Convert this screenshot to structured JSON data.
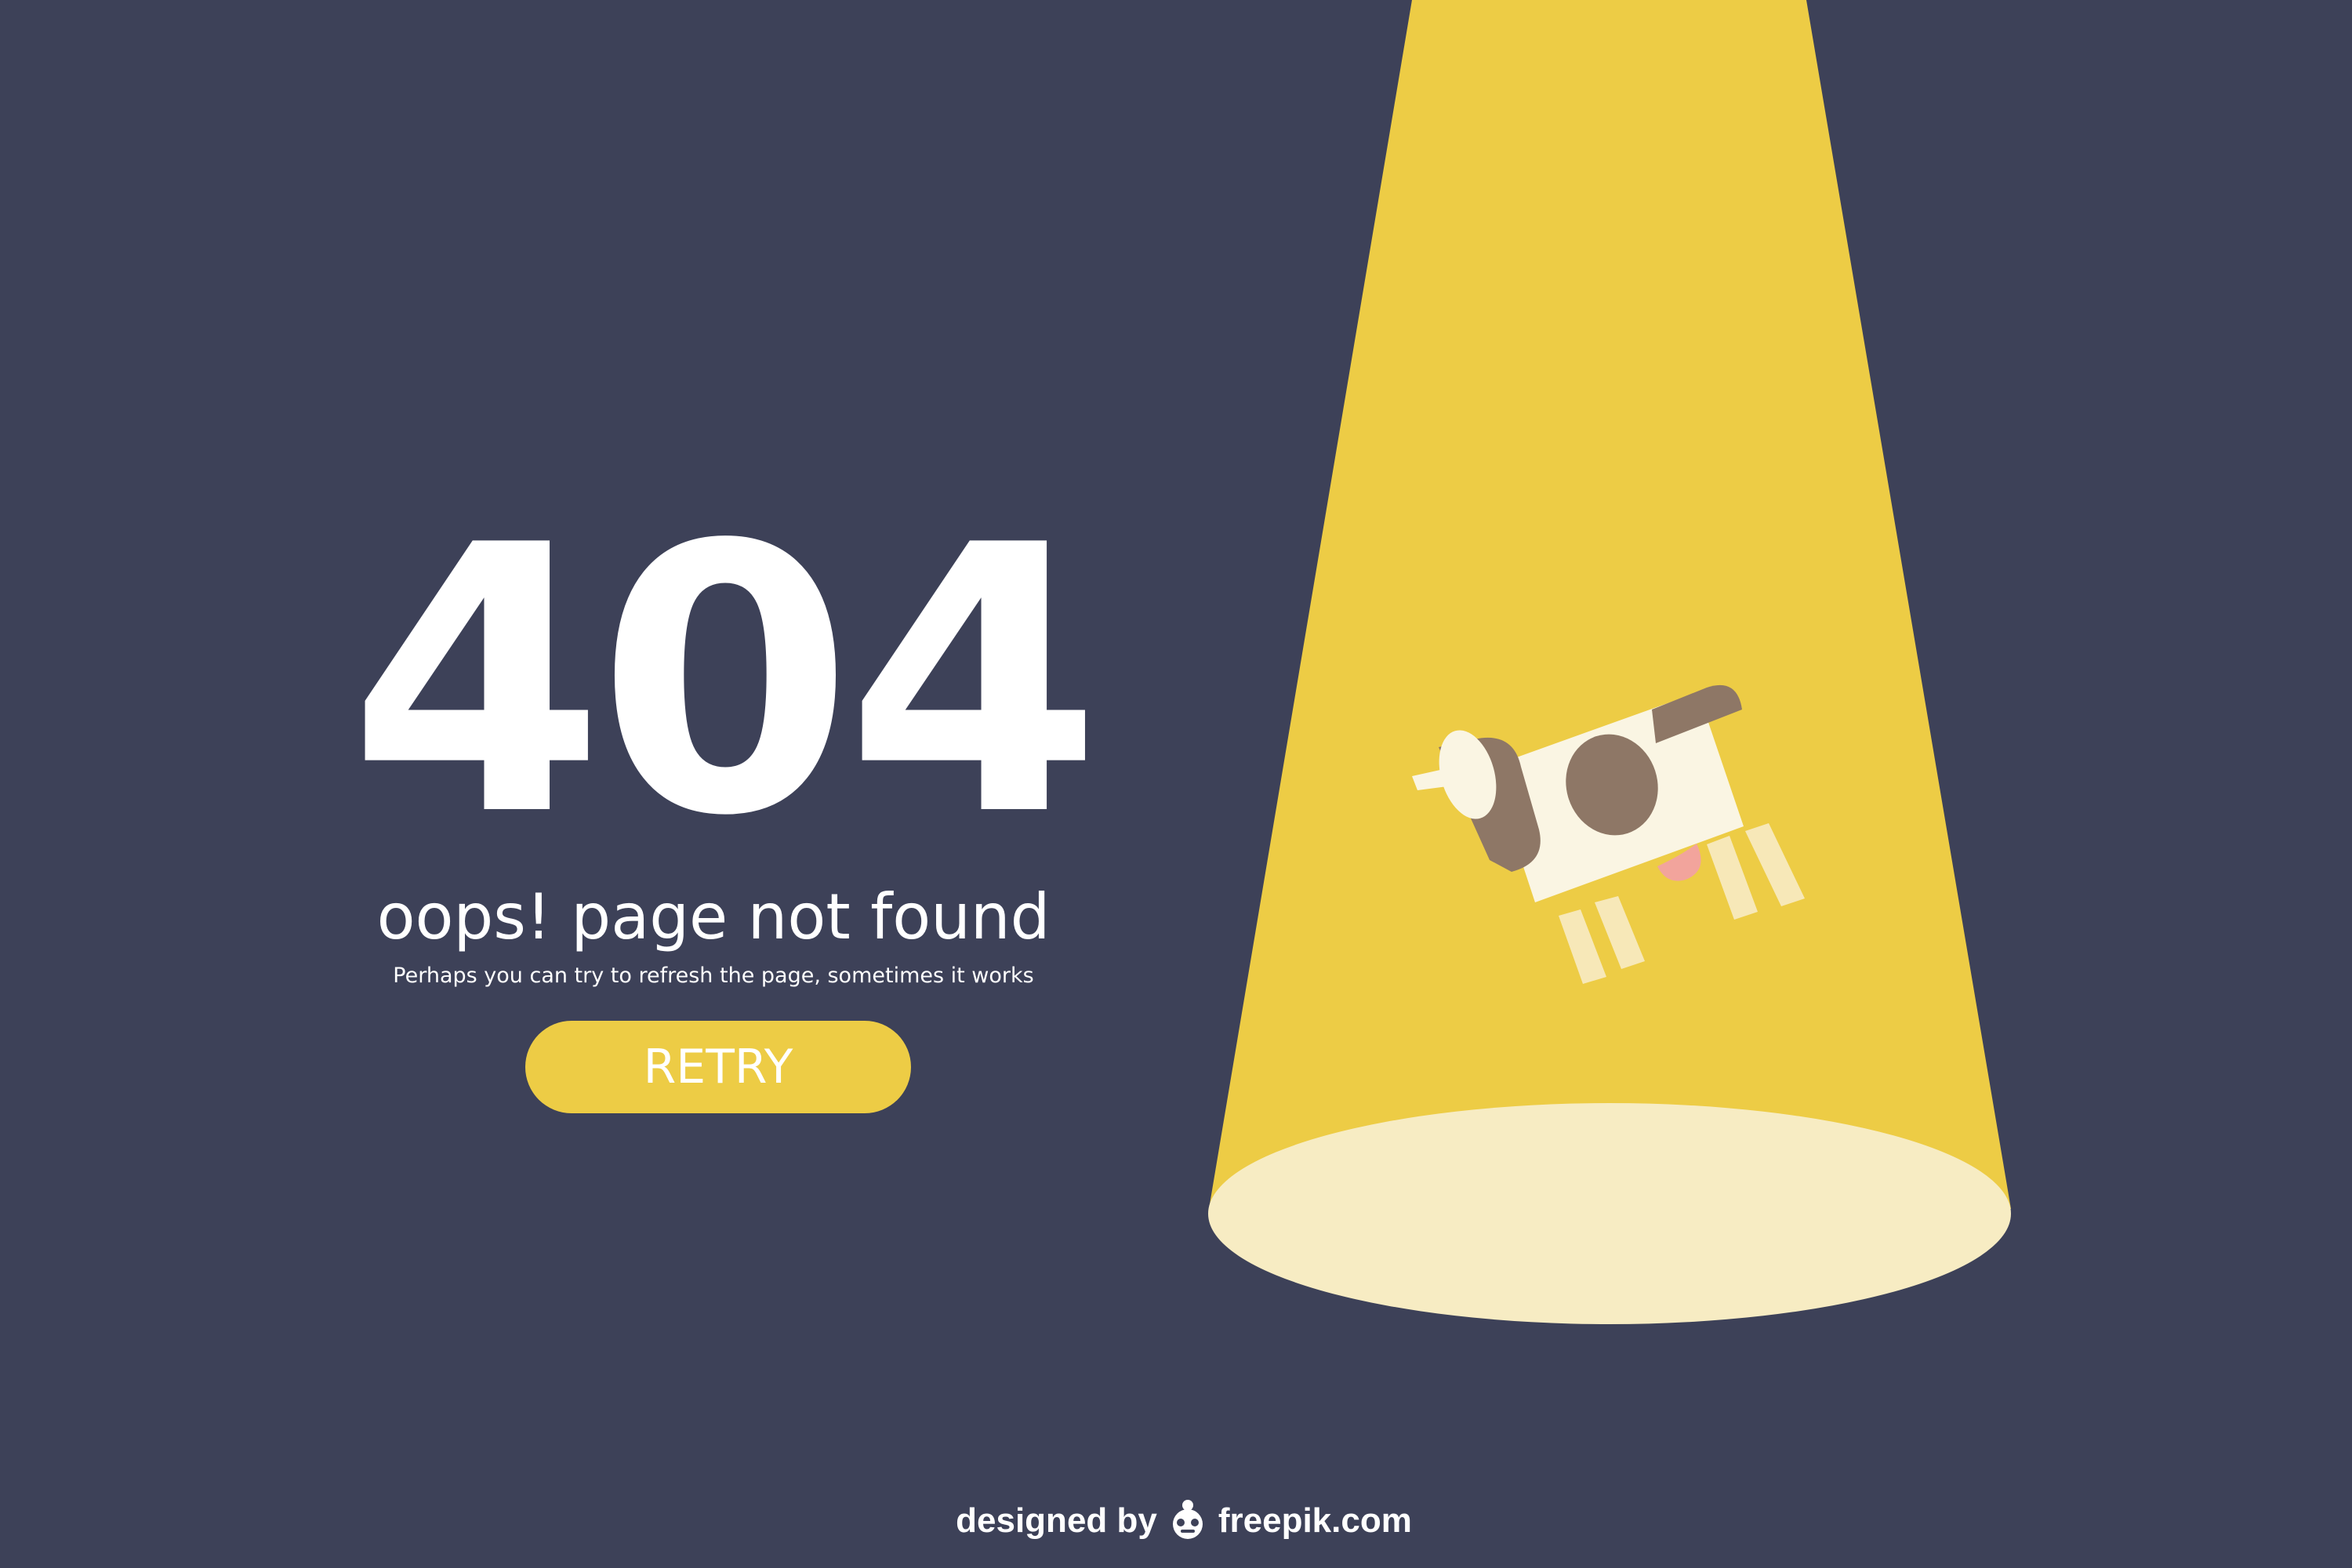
{
  "error": {
    "code": "404",
    "title": "oops! page not found",
    "subtitle": "Perhaps you can try to refresh the page, sometimes it works",
    "retry_label": "RETRY"
  },
  "credit": {
    "prefix": "designed by",
    "brand": "freepik.com",
    "logo_icon": "freepik-logo-icon"
  },
  "illustration": {
    "subject": "cow-icon",
    "light": "spotlight-icon"
  },
  "colors": {
    "background": "#3d4158",
    "spotlight": "#edcc45",
    "spotlight_floor": "#f7ecc3",
    "button": "#edcc45",
    "text": "#ffffff",
    "cow_body": "#faf5e3",
    "cow_spots": "#8e7766",
    "cow_udder": "#f2a49c",
    "cow_legs": "#f7e8b8"
  }
}
